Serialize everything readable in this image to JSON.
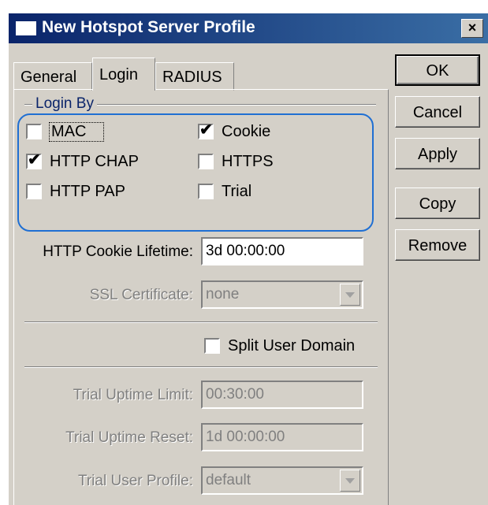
{
  "window": {
    "title": "New Hotspot Server Profile",
    "close_label": "×"
  },
  "tabs": [
    {
      "label": "General",
      "active": false
    },
    {
      "label": "Login",
      "active": true
    },
    {
      "label": "RADIUS",
      "active": false
    }
  ],
  "login_by": {
    "label": "Login By",
    "options": [
      {
        "label": "MAC",
        "checked": false
      },
      {
        "label": "Cookie",
        "checked": true
      },
      {
        "label": "HTTP CHAP",
        "checked": true
      },
      {
        "label": "HTTPS",
        "checked": false
      },
      {
        "label": "HTTP PAP",
        "checked": false
      },
      {
        "label": "Trial",
        "checked": false
      }
    ],
    "check_glyph": "✔"
  },
  "cookie_lifetime": {
    "label": "HTTP Cookie Lifetime:",
    "value": "3d 00:00:00"
  },
  "ssl_certificate": {
    "label": "SSL Certificate:",
    "value": "none"
  },
  "split_user_domain": {
    "label": "Split User Domain",
    "checked": false
  },
  "trial": {
    "uptime_limit": {
      "label": "Trial Uptime Limit:",
      "value": "00:30:00"
    },
    "uptime_reset": {
      "label": "Trial Uptime Reset:",
      "value": "1d 00:00:00"
    },
    "user_profile": {
      "label": "Trial User Profile:",
      "value": "default"
    }
  },
  "buttons": {
    "ok": "OK",
    "cancel": "Cancel",
    "apply": "Apply",
    "copy": "Copy",
    "remove": "Remove"
  },
  "colors": {
    "titlebar": "#0a246a",
    "highlight": "#1f6fd3",
    "face": "#d4d0c8"
  }
}
